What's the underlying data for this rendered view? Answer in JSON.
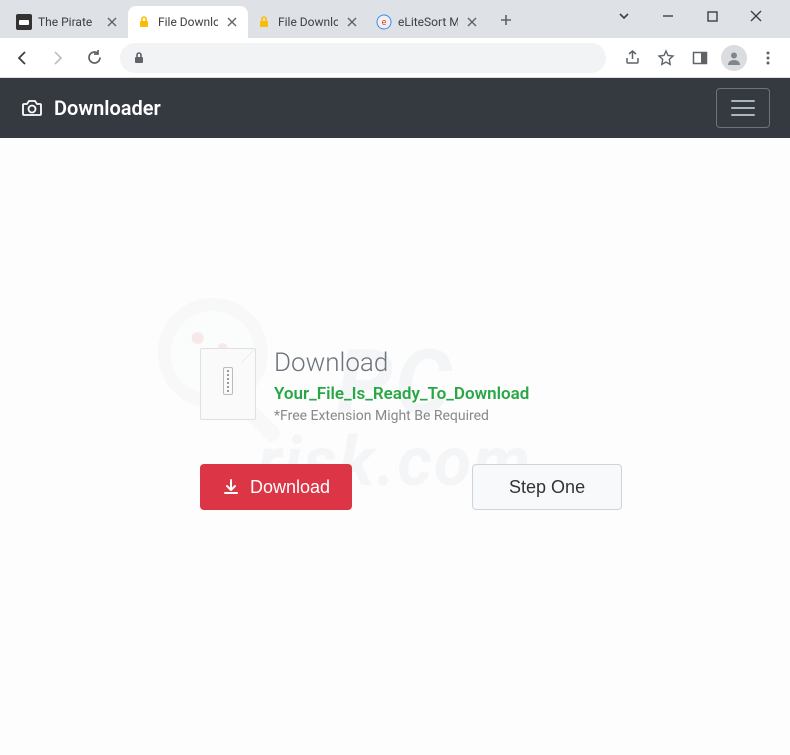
{
  "browser": {
    "tabs": [
      {
        "title": "The Pirate",
        "active": false,
        "favicon": "pirate"
      },
      {
        "title": "File Downlo",
        "active": true,
        "favicon": "lock"
      },
      {
        "title": "File Downlo",
        "active": false,
        "favicon": "lock"
      },
      {
        "title": "eLiteSort M",
        "active": false,
        "favicon": "sort"
      }
    ]
  },
  "app": {
    "brand": "Downloader"
  },
  "download": {
    "heading": "Download",
    "ready": "Your_File_Is_Ready_To_Download",
    "note": "*Free Extension Might Be Required",
    "button": "Download",
    "step_button": "Step One"
  },
  "watermark": {
    "line1": "PC",
    "line2": "risk.com"
  }
}
